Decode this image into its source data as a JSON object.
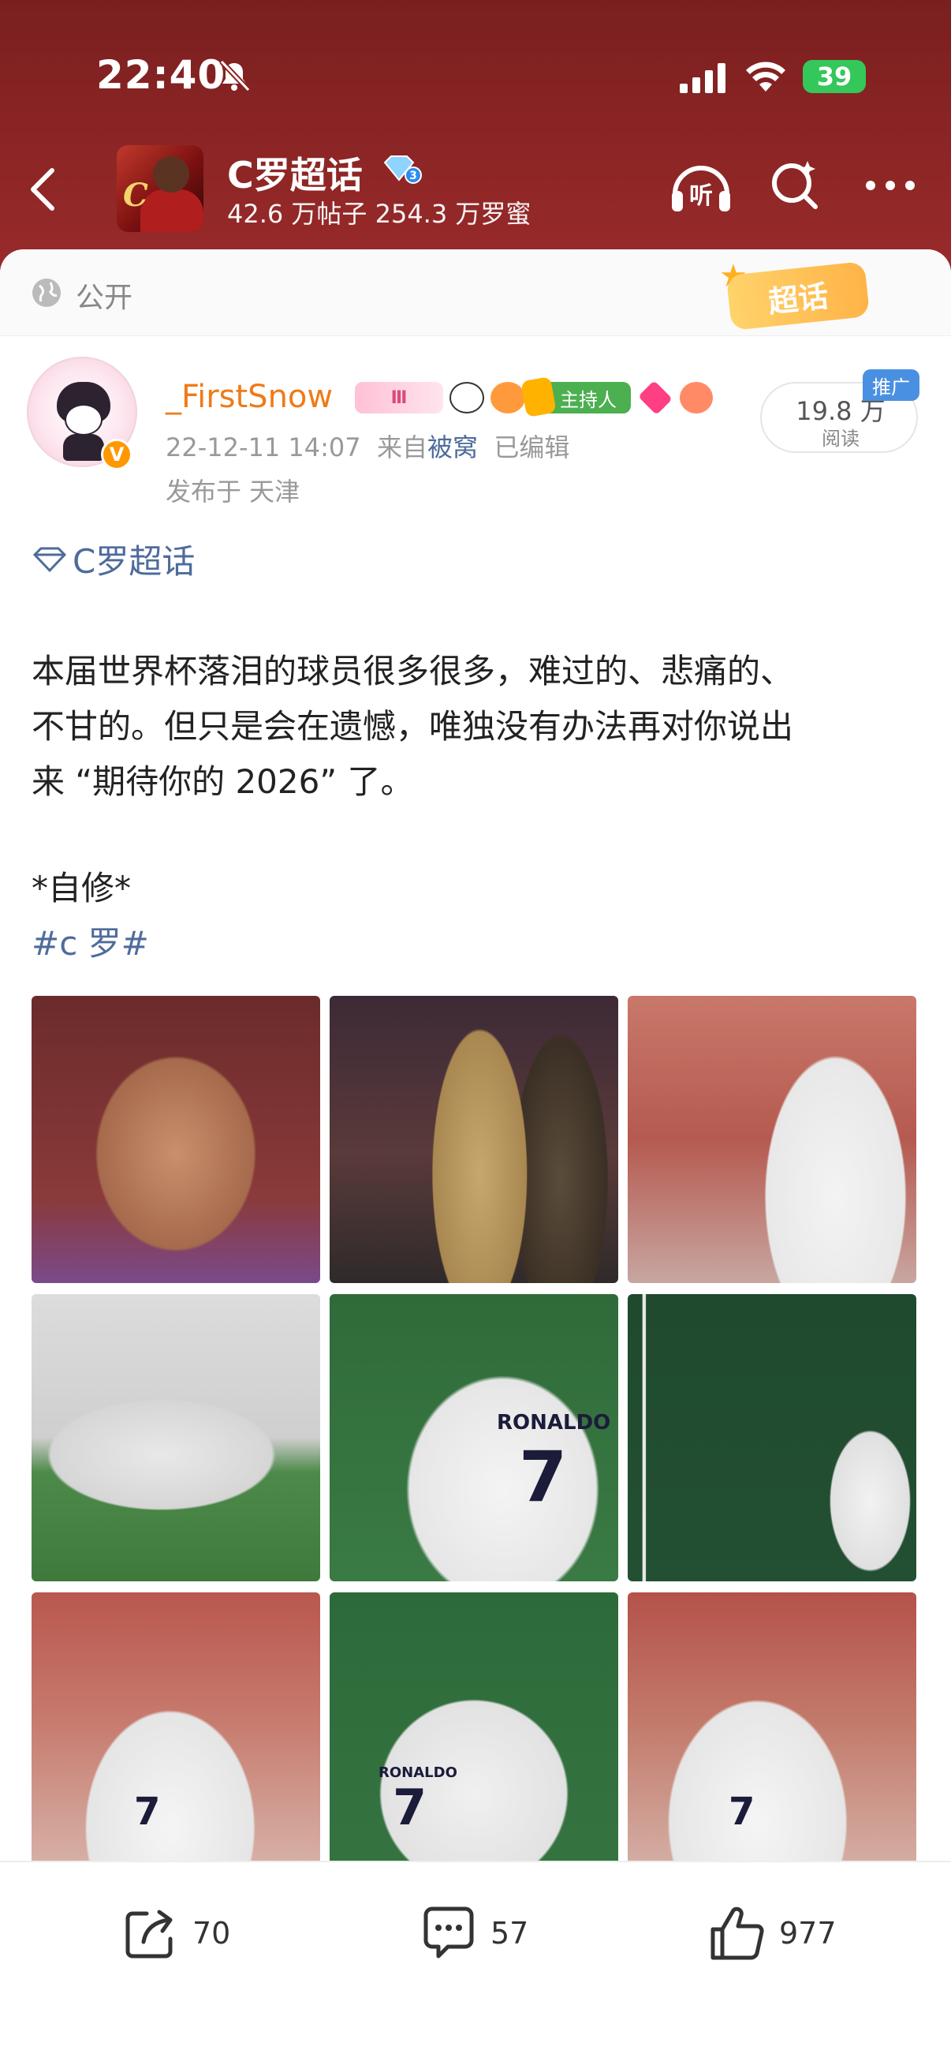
{
  "status_bar": {
    "time": "22:40",
    "battery": "39"
  },
  "topic": {
    "name": "C罗超话",
    "stats": "42.6 万帖子 254.3 万罗蜜",
    "avatar_text": "C"
  },
  "post": {
    "visibility": "公开",
    "super_tag": "超话",
    "author": "_FirstSnow",
    "badges": {
      "level": "Ⅲ",
      "host": "主持人"
    },
    "timestamp": "22-12-11 14:07",
    "source_prefix": "来自",
    "source": "被窝",
    "edited": "已编辑",
    "location": "发布于 天津",
    "reads": "19.8 万",
    "reads_label": "阅读",
    "promo": "推广",
    "topic_link": "C罗超话",
    "body_lines": [
      "本届世界杯落泪的球员很多很多，难过的、悲痛的、",
      "不甘的。但只是会在遗憾，唯独没有办法再对你说出",
      "来 “期待你的 2026” 了。"
    ],
    "note": "*自修*",
    "hashtag": "#c 罗#",
    "photo_texts": {
      "jersey_name_5": "RONALDO",
      "jersey_num_5": "7",
      "jersey_name_8": "RONALDO",
      "jersey_num_8": "7",
      "jersey_num_7": "7",
      "jersey_num_9": "7"
    }
  },
  "actions": {
    "share_count": "70",
    "comment_count": "57",
    "like_count": "977"
  },
  "colors": {
    "header_bg": "#8a2424",
    "link_blue": "#4e6b9b",
    "username_orange": "#f07a18",
    "battery_green": "#34c759"
  }
}
